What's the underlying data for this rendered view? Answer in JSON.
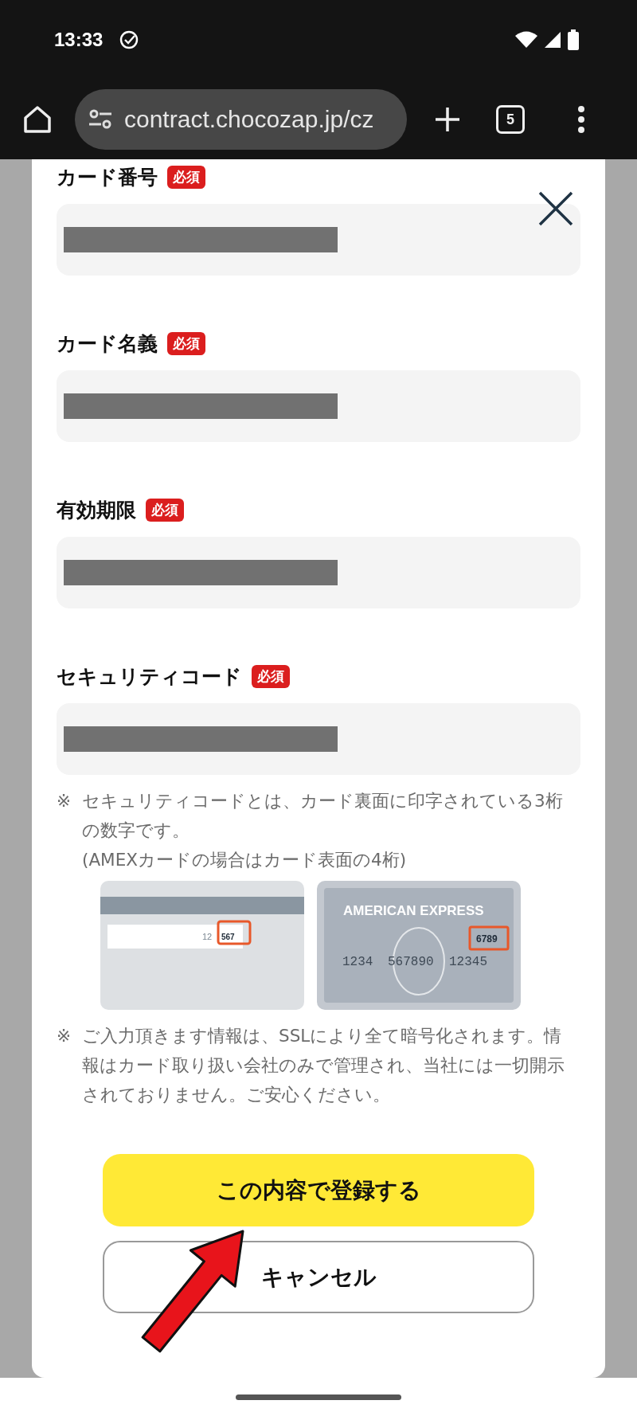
{
  "status_bar": {
    "time": "13:33"
  },
  "browser": {
    "url": "contract.chocozap.jp/cz",
    "tab_count": "5"
  },
  "form": {
    "fields": [
      {
        "label": "カード番号",
        "badge": "必須",
        "redacted": true
      },
      {
        "label": "カード名義",
        "badge": "必須",
        "redacted": true
      },
      {
        "label": "有効期限",
        "badge": "必須",
        "redacted": true
      },
      {
        "label": "セキュリティコード",
        "badge": "必須",
        "redacted": true
      }
    ],
    "notes_mark": "※",
    "note_security": [
      "セキュリティコードとは、カード裏面に印字されている3桁の数字です。",
      "(AMEXカードの場合はカード表面の4桁)"
    ],
    "card_back": {
      "faded_digits": "12",
      "code": "567"
    },
    "card_front": {
      "brand": "AMERICAN EXPRESS",
      "code": "6789",
      "number": [
        "1234",
        "567890",
        "12345"
      ]
    },
    "note_ssl": "ご入力頂きます情報は、SSLにより全て暗号化されます。情報はカード取り扱い会社のみで管理され、当社には一切開示されておりません。ご安心ください。",
    "buttons": [
      {
        "label": "この内容で登録する",
        "kind": "primary"
      },
      {
        "label": "キャンセル",
        "kind": "secondary"
      }
    ]
  }
}
